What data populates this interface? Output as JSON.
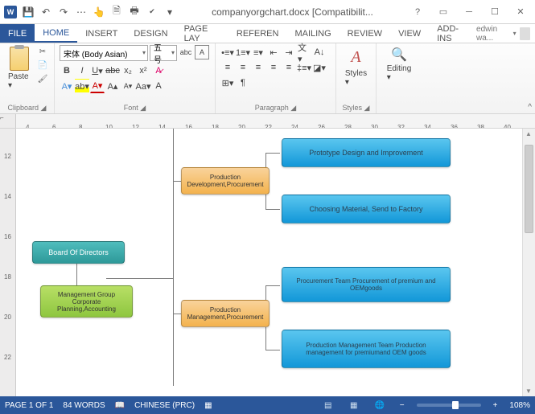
{
  "title": "companyorgchart.docx [Compatibilit...",
  "qat": {
    "save": "💾",
    "undo": "↶",
    "redo": "↷"
  },
  "tabs": [
    "FILE",
    "HOME",
    "INSERT",
    "DESIGN",
    "PAGE LAY",
    "REFEREN",
    "MAILING",
    "REVIEW",
    "VIEW",
    "ADD-INS"
  ],
  "active_tab": "HOME",
  "account": "edwin wa...",
  "ribbon": {
    "clipboard": {
      "paste": "Paste",
      "label": "Clipboard"
    },
    "font": {
      "name": "宋体 (Body Asian)",
      "size": "五号",
      "label": "Font"
    },
    "paragraph": {
      "label": "Paragraph"
    },
    "styles": {
      "btn": "Styles",
      "label": "Styles"
    },
    "editing": {
      "btn": "Editing"
    }
  },
  "ruler_h": [
    4,
    6,
    8,
    10,
    12,
    14,
    16,
    18,
    20,
    22,
    24,
    26,
    28,
    30,
    32,
    34,
    36,
    38,
    40
  ],
  "ruler_v": [
    12,
    14,
    16,
    18,
    20,
    22
  ],
  "orgchart": {
    "board": "Board Of Directors",
    "mgmt": "Management Group Corporate Planning,Accounting",
    "proddev": "Production Development,Procurement",
    "prodmgmt": "Production Management,Procurement",
    "proto": "Prototype Design and Improvement",
    "material": "Choosing Material, Send to Factory",
    "procure": "Procurement Team Procurement of premium and OEMgoods",
    "prodmgmt_team": "Production Management Team Production management for premiumand OEM goods"
  },
  "status": {
    "page": "PAGE 1 OF 1",
    "words": "84 WORDS",
    "lang": "CHINESE (PRC)",
    "zoom": "108%"
  }
}
